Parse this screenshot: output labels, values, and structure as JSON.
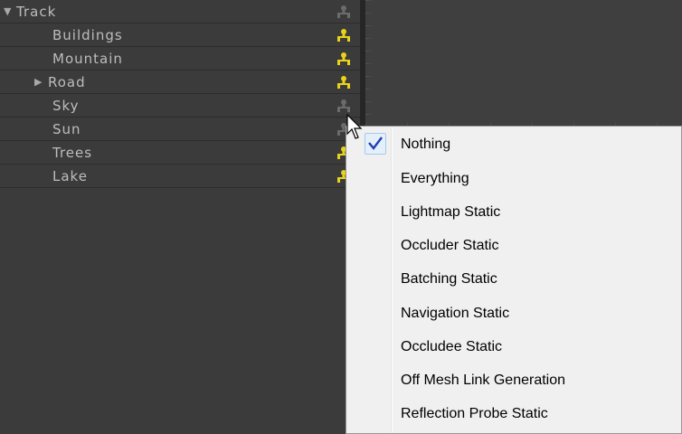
{
  "hierarchy": {
    "items": [
      {
        "label": "Track",
        "expander": "▼",
        "prefab_icon": "prefab-icon",
        "prefab_color": "#6b6b6b"
      },
      {
        "label": "Buildings",
        "prefab_icon": "prefab-icon",
        "prefab_color": "#e8d21a"
      },
      {
        "label": "Mountain",
        "prefab_icon": "prefab-icon",
        "prefab_color": "#e8d21a"
      },
      {
        "label": "Road",
        "expander": "▶",
        "prefab_icon": "prefab-icon",
        "prefab_color": "#e8d21a"
      },
      {
        "label": "Sky",
        "prefab_icon": "prefab-icon",
        "prefab_color": "#6b6b6b"
      },
      {
        "label": "Sun",
        "prefab_icon": "prefab-icon",
        "prefab_color": "#6b6b6b"
      },
      {
        "label": "Trees",
        "prefab_icon": "prefab-icon",
        "prefab_color": "#e8d21a"
      },
      {
        "label": "Lake",
        "prefab_icon": "prefab-icon",
        "prefab_color": "#e8d21a"
      }
    ]
  },
  "static_flags_menu": {
    "items": [
      {
        "label": "Nothing",
        "checked": true
      },
      {
        "label": "Everything",
        "checked": false
      },
      {
        "label": "Lightmap Static",
        "checked": false
      },
      {
        "label": "Occluder Static",
        "checked": false
      },
      {
        "label": "Batching Static",
        "checked": false
      },
      {
        "label": "Navigation Static",
        "checked": false
      },
      {
        "label": "Occludee Static",
        "checked": false
      },
      {
        "label": "Off Mesh Link Generation",
        "checked": false
      },
      {
        "label": "Reflection Probe Static",
        "checked": false
      }
    ],
    "check_icon": "checkmark-icon",
    "check_color": "#1f3fb0"
  },
  "colors": {
    "hierarchy_bg": "#3b3b3b",
    "menu_bg": "#f0f0f0",
    "text_light": "#bdbdbd"
  }
}
